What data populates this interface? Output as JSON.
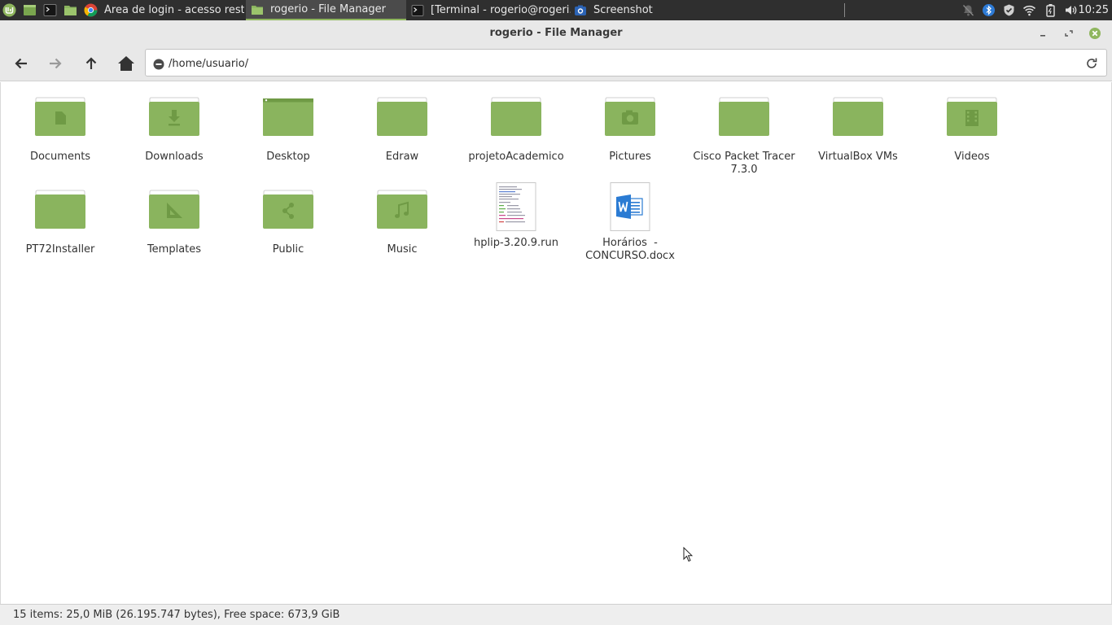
{
  "panel": {
    "tasks": [
      {
        "label": "Área de login - acesso rest..."
      },
      {
        "label": "rogerio - File Manager"
      },
      {
        "label": "[Terminal - rogerio@rogeri..."
      },
      {
        "label": "Screenshot"
      }
    ],
    "clock": "10:25"
  },
  "window": {
    "title": "rogerio - File Manager"
  },
  "toolbar": {
    "location": "/home/usuario/"
  },
  "items": [
    {
      "name": "Documents",
      "icon": "documents-folder-icon"
    },
    {
      "name": "Downloads",
      "icon": "downloads-folder-icon"
    },
    {
      "name": "Desktop",
      "icon": "desktop-folder-icon"
    },
    {
      "name": "Edraw",
      "icon": "folder-icon"
    },
    {
      "name": "projetoAcademico",
      "icon": "folder-icon"
    },
    {
      "name": "Pictures",
      "icon": "pictures-folder-icon"
    },
    {
      "name": "Cisco Packet Tracer 7.3.0",
      "icon": "folder-icon"
    },
    {
      "name": "VirtualBox VMs",
      "icon": "folder-icon"
    },
    {
      "name": "Videos",
      "icon": "videos-folder-icon"
    },
    {
      "name": "PT72Installer",
      "icon": "folder-icon"
    },
    {
      "name": "Templates",
      "icon": "templates-folder-icon"
    },
    {
      "name": "Public",
      "icon": "public-folder-icon"
    },
    {
      "name": "Music",
      "icon": "music-folder-icon"
    },
    {
      "name": "hplip-3.20.9.run",
      "icon": "script-file-icon"
    },
    {
      "name": "Horários  - CONCURSO.docx",
      "icon": "word-document-icon"
    }
  ],
  "status": {
    "text": "15 items: 25,0 MiB (26.195.747 bytes), Free space: 673,9 GiB"
  },
  "colors": {
    "folder": "#8ab45e",
    "folder_dark": "#6f9a45",
    "panel_bg": "#2f2f2f",
    "accent": "#8fb65e",
    "word_blue": "#2a7bd3"
  }
}
